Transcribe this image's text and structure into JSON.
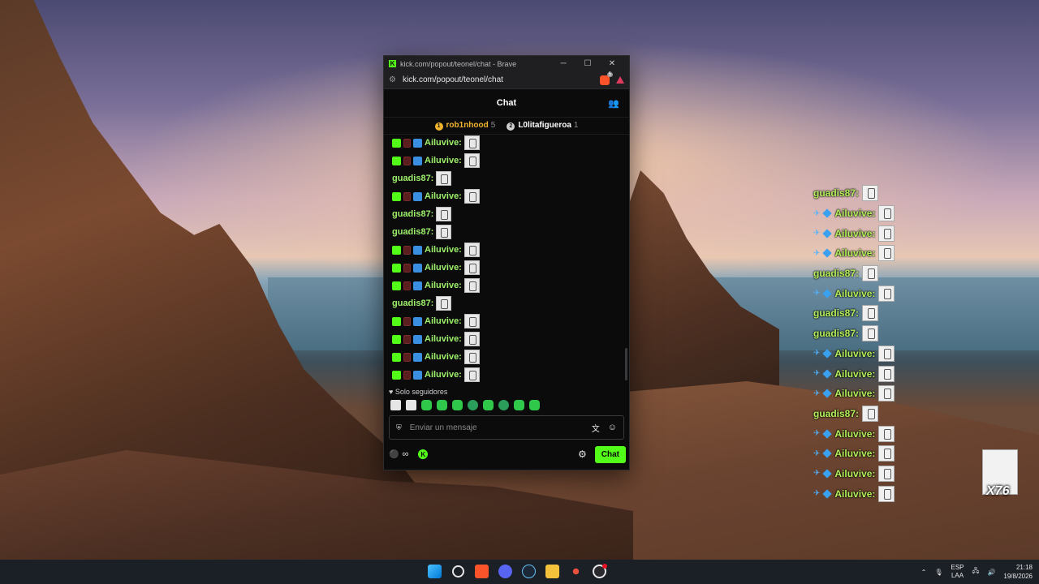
{
  "browser": {
    "title": "kick.com/popout/teonel/chat - Brave",
    "url": "kick.com/popout/teonel/chat",
    "brave_badge_count": "5",
    "minimize": "─",
    "maximize": "☐",
    "close": "✕"
  },
  "chat": {
    "header_title": "Chat",
    "pinned": [
      {
        "rank": "1",
        "name": "rob1nhood",
        "count": "5"
      },
      {
        "rank": "2",
        "name": "L0litafigueroa",
        "count": "1"
      }
    ],
    "messages": [
      {
        "user": "Ailuvive:",
        "color": "#9ef26b",
        "badges": true
      },
      {
        "user": "Ailuvive:",
        "color": "#9ef26b",
        "badges": true
      },
      {
        "user": "guadis87:",
        "color": "#9ef26b",
        "badges": false
      },
      {
        "user": "Ailuvive:",
        "color": "#9ef26b",
        "badges": true
      },
      {
        "user": "guadis87:",
        "color": "#9ef26b",
        "badges": false
      },
      {
        "user": "guadis87:",
        "color": "#9ef26b",
        "badges": false
      },
      {
        "user": "Ailuvive:",
        "color": "#9ef26b",
        "badges": true
      },
      {
        "user": "Ailuvive:",
        "color": "#9ef26b",
        "badges": true
      },
      {
        "user": "Ailuvive:",
        "color": "#9ef26b",
        "badges": true
      },
      {
        "user": "guadis87:",
        "color": "#9ef26b",
        "badges": false
      },
      {
        "user": "Ailuvive:",
        "color": "#9ef26b",
        "badges": true
      },
      {
        "user": "Ailuvive:",
        "color": "#9ef26b",
        "badges": true
      },
      {
        "user": "Ailuvive:",
        "color": "#9ef26b",
        "badges": true
      },
      {
        "user": "Ailuvive:",
        "color": "#9ef26b",
        "badges": true
      }
    ],
    "followers_only": "Solo seguidores",
    "input_placeholder": "Enviar un mensaje",
    "send_label": "Chat",
    "infinity": "∞"
  },
  "overlay": {
    "messages": [
      {
        "user": "guadis87:",
        "badges": false
      },
      {
        "user": "Ailuvive:",
        "badges": true
      },
      {
        "user": "Ailuvive:",
        "badges": true
      },
      {
        "user": "Ailuvive:",
        "badges": true
      },
      {
        "user": "guadis87:",
        "badges": false
      },
      {
        "user": "Ailuvive:",
        "badges": true
      },
      {
        "user": "guadis87:",
        "badges": false
      },
      {
        "user": "guadis87:",
        "badges": false
      },
      {
        "user": "Ailuvive:",
        "badges": true
      },
      {
        "user": "Ailuvive:",
        "badges": true
      },
      {
        "user": "Ailuvive:",
        "badges": true
      },
      {
        "user": "guadis87:",
        "badges": false
      },
      {
        "user": "Ailuvive:",
        "badges": true
      },
      {
        "user": "Ailuvive:",
        "badges": true
      },
      {
        "user": "Ailuvive:",
        "badges": true
      },
      {
        "user": "Ailuvive:",
        "badges": true
      }
    ],
    "user_color": "#b4f05a",
    "big_emote_multiplier": "X76"
  },
  "taskbar": {
    "language_line1": "ESP",
    "language_line2": "LAA",
    "time": "21:18",
    "date": "19/8/2026"
  }
}
